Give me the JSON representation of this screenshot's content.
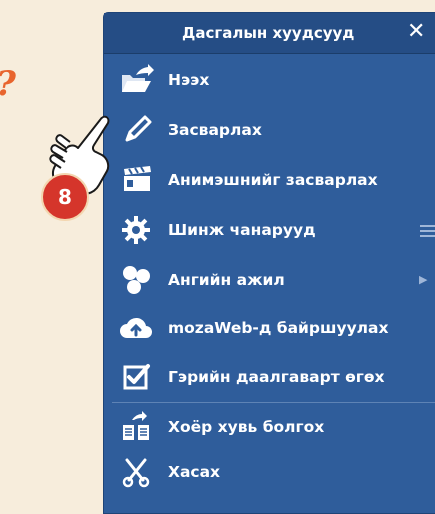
{
  "question_mark": "?",
  "menu": {
    "title": "Дасгалын хуудсууд",
    "close_glyph": "✕",
    "items": [
      {
        "label": "Нээх",
        "icon": "open-folder-icon"
      },
      {
        "label": "Засварлах",
        "icon": "pencil-icon"
      },
      {
        "label": "Анимэшнийг засварлах",
        "icon": "film-clapper-icon"
      },
      {
        "label": "Шинж чанарууд",
        "icon": "gear-icon"
      },
      {
        "label": "Ангийн ажил",
        "icon": "classwork-icon"
      },
      {
        "label": "mozaWeb-д байршуулах",
        "icon": "cloud-upload-icon"
      },
      {
        "label": "Гэрийн даалгаварт өгөх",
        "icon": "homework-checkbox-icon"
      },
      {
        "label": "Хоёр хувь болгох",
        "icon": "duplicate-icon"
      },
      {
        "label": "Хасах",
        "icon": "scissors-icon"
      }
    ]
  },
  "step_badge": "8"
}
